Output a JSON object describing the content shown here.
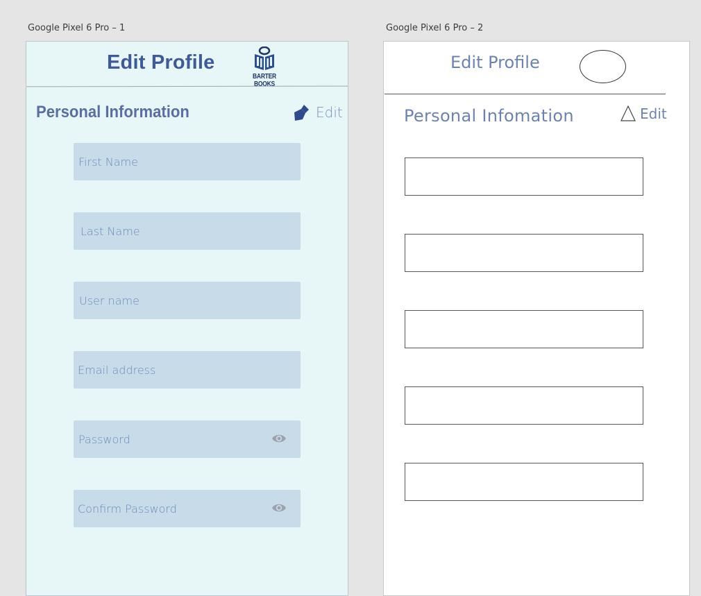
{
  "artboard1": {
    "label": "Google Pixel 6 Pro – 1",
    "title": "Edit Profile",
    "logo_text": "BARTER BOOKS",
    "section_title": "Personal Information",
    "edit_label": "Edit",
    "fields": [
      {
        "placeholder": "First Name"
      },
      {
        "placeholder": "Last Name"
      },
      {
        "placeholder": "User name"
      },
      {
        "placeholder": "Email address"
      },
      {
        "placeholder": "Password",
        "icon": "eye-icon"
      },
      {
        "placeholder": "Confirm Password",
        "icon": "eye-icon"
      }
    ],
    "colors": {
      "background": "#e7f7f8",
      "field": "#c8dbe8",
      "accent": "#3f5a96"
    }
  },
  "artboard2": {
    "label": "Google Pixel 6 Pro – 2",
    "title": "Edit Profile",
    "section_title": "Personal Infomation",
    "edit_label": "Edit",
    "field_count": 5,
    "colors": {
      "background": "#ffffff",
      "accent": "#6c83b2"
    }
  }
}
